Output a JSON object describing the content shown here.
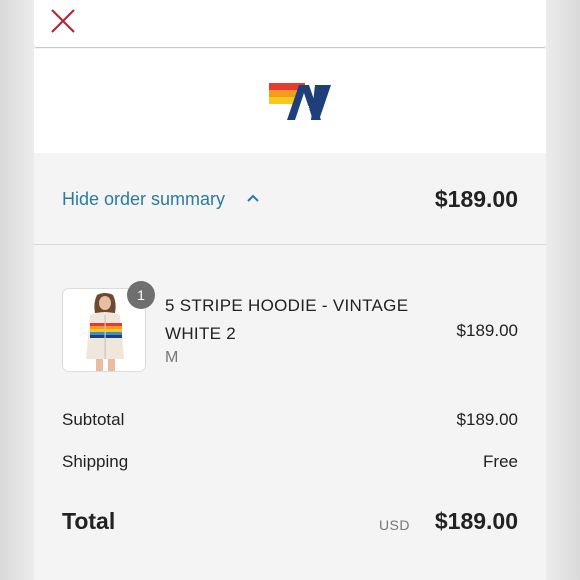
{
  "header": {
    "close_icon": "close-icon"
  },
  "brand": {
    "logo_icon": "brand-logo"
  },
  "summary_toggle": {
    "label": "Hide order summary",
    "chevron_icon": "chevron-up-icon",
    "total": "$189.00"
  },
  "line_items": [
    {
      "quantity": "1",
      "name": "5 STRIPE HOODIE - VINTAGE WHITE 2",
      "variant": "M",
      "price": "$189.00"
    }
  ],
  "totals": {
    "subtotal_label": "Subtotal",
    "subtotal_value": "$189.00",
    "shipping_label": "Shipping",
    "shipping_value": "Free",
    "total_label": "Total",
    "currency": "USD",
    "total_value": "$189.00"
  },
  "colors": {
    "link": "#2a7aa5",
    "close": "#b02a3a",
    "logo_navy": "#1f3f7a",
    "stripe_red": "#e63c2f",
    "stripe_orange": "#f39a20",
    "stripe_yellow": "#f6c81e"
  }
}
